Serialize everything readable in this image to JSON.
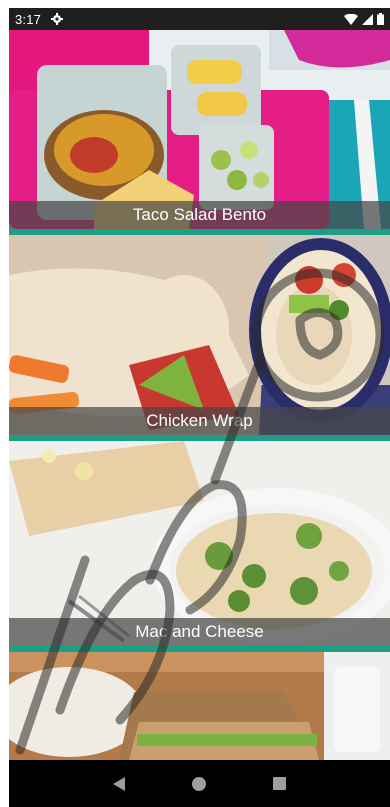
{
  "status_bar": {
    "time": "3:17",
    "icons": [
      "gear-icon",
      "wifi-icon",
      "signal-icon",
      "battery-icon"
    ]
  },
  "recipes": [
    {
      "title": "Taco Salad Bento"
    },
    {
      "title": "Chicken Wrap"
    },
    {
      "title": "Mac and Cheese"
    },
    {
      "title": ""
    }
  ],
  "nav_bar": {
    "buttons": [
      "back-icon",
      "home-icon",
      "recents-icon"
    ]
  },
  "colors": {
    "divider": "#1f9e86",
    "status_bar": "#1f1f1f",
    "nav_bar": "#000000",
    "caption_bg": "#464646"
  }
}
